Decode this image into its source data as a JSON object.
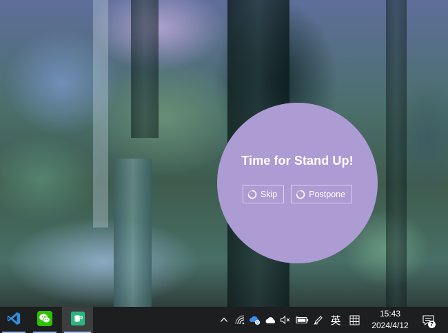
{
  "popup": {
    "title": "Time for Stand Up!",
    "skip_label": "Skip",
    "postpone_label": "Postpone",
    "background_color": "#ad9bd3"
  },
  "taskbar": {
    "apps": [
      {
        "name": "Visual Studio Code",
        "icon": "vscode-icon",
        "active": false
      },
      {
        "name": "WeChat",
        "icon": "wechat-icon",
        "active": false
      },
      {
        "name": "Stretchly",
        "icon": "break-reminder-icon",
        "active": true
      }
    ],
    "tray": {
      "overflow_icon": "chevron-up-icon",
      "icons": [
        "wifi-icon",
        "onedrive-sync-icon",
        "cloud-icon",
        "volume-muted-icon",
        "battery-icon",
        "pen-icon"
      ],
      "ime_mode": "英",
      "ime_layout_icon": "ime-grid-icon"
    },
    "clock": {
      "time": "15:43",
      "date": "2024/4/12"
    },
    "notifications": {
      "count": "7",
      "icon": "notification-center-icon"
    }
  }
}
